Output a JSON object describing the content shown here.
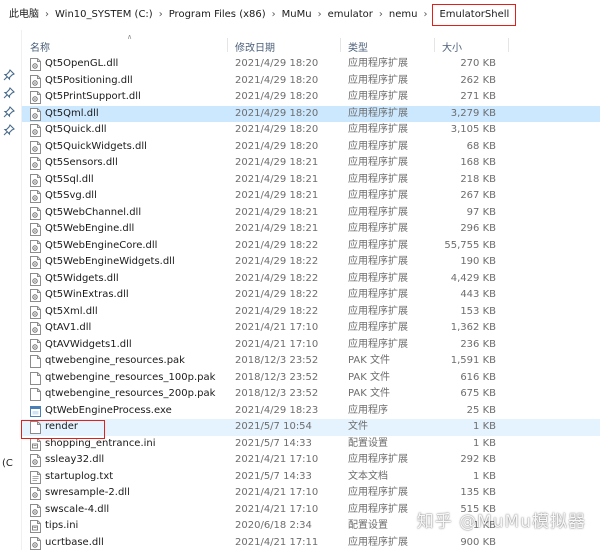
{
  "breadcrumb": {
    "items": [
      "此电脑",
      "Win10_SYSTEM (C:)",
      "Program Files (x86)",
      "MuMu",
      "emulator",
      "nemu"
    ],
    "current": "EmulatorShell"
  },
  "nav": {
    "partial_label": "(C"
  },
  "columns": {
    "name": "名称",
    "date": "修改日期",
    "type": "类型",
    "size": "大小"
  },
  "files": [
    {
      "name": "Qt5OpenGL.dll",
      "date": "2021/4/29 18:20",
      "type": "应用程序扩展",
      "size": "270 KB",
      "icon": "dll-file-icon"
    },
    {
      "name": "Qt5Positioning.dll",
      "date": "2021/4/29 18:20",
      "type": "应用程序扩展",
      "size": "262 KB",
      "icon": "dll-file-icon"
    },
    {
      "name": "Qt5PrintSupport.dll",
      "date": "2021/4/29 18:20",
      "type": "应用程序扩展",
      "size": "271 KB",
      "icon": "dll-file-icon"
    },
    {
      "name": "Qt5Qml.dll",
      "date": "2021/4/29 18:20",
      "type": "应用程序扩展",
      "size": "3,279 KB",
      "icon": "dll-file-icon"
    },
    {
      "name": "Qt5Quick.dll",
      "date": "2021/4/29 18:20",
      "type": "应用程序扩展",
      "size": "3,105 KB",
      "icon": "dll-file-icon"
    },
    {
      "name": "Qt5QuickWidgets.dll",
      "date": "2021/4/29 18:20",
      "type": "应用程序扩展",
      "size": "68 KB",
      "icon": "dll-file-icon"
    },
    {
      "name": "Qt5Sensors.dll",
      "date": "2021/4/29 18:21",
      "type": "应用程序扩展",
      "size": "168 KB",
      "icon": "dll-file-icon"
    },
    {
      "name": "Qt5Sql.dll",
      "date": "2021/4/29 18:21",
      "type": "应用程序扩展",
      "size": "218 KB",
      "icon": "dll-file-icon"
    },
    {
      "name": "Qt5Svg.dll",
      "date": "2021/4/29 18:21",
      "type": "应用程序扩展",
      "size": "267 KB",
      "icon": "dll-file-icon"
    },
    {
      "name": "Qt5WebChannel.dll",
      "date": "2021/4/29 18:21",
      "type": "应用程序扩展",
      "size": "97 KB",
      "icon": "dll-file-icon"
    },
    {
      "name": "Qt5WebEngine.dll",
      "date": "2021/4/29 18:21",
      "type": "应用程序扩展",
      "size": "296 KB",
      "icon": "dll-file-icon"
    },
    {
      "name": "Qt5WebEngineCore.dll",
      "date": "2021/4/29 18:22",
      "type": "应用程序扩展",
      "size": "55,755 KB",
      "icon": "dll-file-icon"
    },
    {
      "name": "Qt5WebEngineWidgets.dll",
      "date": "2021/4/29 18:22",
      "type": "应用程序扩展",
      "size": "190 KB",
      "icon": "dll-file-icon"
    },
    {
      "name": "Qt5Widgets.dll",
      "date": "2021/4/29 18:22",
      "type": "应用程序扩展",
      "size": "4,429 KB",
      "icon": "dll-file-icon"
    },
    {
      "name": "Qt5WinExtras.dll",
      "date": "2021/4/29 18:22",
      "type": "应用程序扩展",
      "size": "443 KB",
      "icon": "dll-file-icon"
    },
    {
      "name": "Qt5Xml.dll",
      "date": "2021/4/29 18:22",
      "type": "应用程序扩展",
      "size": "153 KB",
      "icon": "dll-file-icon"
    },
    {
      "name": "QtAV1.dll",
      "date": "2021/4/21 17:10",
      "type": "应用程序扩展",
      "size": "1,362 KB",
      "icon": "dll-file-icon"
    },
    {
      "name": "QtAVWidgets1.dll",
      "date": "2021/4/21 17:10",
      "type": "应用程序扩展",
      "size": "236 KB",
      "icon": "dll-file-icon"
    },
    {
      "name": "qtwebengine_resources.pak",
      "date": "2018/12/3 23:52",
      "type": "PAK 文件",
      "size": "1,591 KB",
      "icon": "document-file-icon"
    },
    {
      "name": "qtwebengine_resources_100p.pak",
      "date": "2018/12/3 23:52",
      "type": "PAK 文件",
      "size": "616 KB",
      "icon": "document-file-icon"
    },
    {
      "name": "qtwebengine_resources_200p.pak",
      "date": "2018/12/3 23:52",
      "type": "PAK 文件",
      "size": "675 KB",
      "icon": "document-file-icon"
    },
    {
      "name": "QtWebEngineProcess.exe",
      "date": "2021/4/29 18:23",
      "type": "应用程序",
      "size": "25 KB",
      "icon": "application-icon"
    },
    {
      "name": "render",
      "date": "2021/5/7 10:54",
      "type": "文件",
      "size": "1 KB",
      "icon": "blank-file-icon"
    },
    {
      "name": "shopping_entrance.ini",
      "date": "2021/5/7 14:33",
      "type": "配置设置",
      "size": "1 KB",
      "icon": "ini-file-icon"
    },
    {
      "name": "ssleay32.dll",
      "date": "2021/4/21 17:10",
      "type": "应用程序扩展",
      "size": "292 KB",
      "icon": "dll-file-icon"
    },
    {
      "name": "startuplog.txt",
      "date": "2021/5/7 14:33",
      "type": "文本文档",
      "size": "1 KB",
      "icon": "text-file-icon"
    },
    {
      "name": "swresample-2.dll",
      "date": "2021/4/21 17:10",
      "type": "应用程序扩展",
      "size": "135 KB",
      "icon": "dll-file-icon"
    },
    {
      "name": "swscale-4.dll",
      "date": "2021/4/21 17:10",
      "type": "应用程序扩展",
      "size": "515 KB",
      "icon": "dll-file-icon"
    },
    {
      "name": "tips.ini",
      "date": "2020/6/18 2:34",
      "type": "配置设置",
      "size": "1 KB",
      "icon": "ini-file-icon"
    },
    {
      "name": "ucrtbase.dll",
      "date": "2021/4/21 17:11",
      "type": "应用程序扩展",
      "size": "900 KB",
      "icon": "dll-file-icon"
    }
  ],
  "selected_index": 3,
  "highlighted_index": 22,
  "watermark": "知乎 @MuMu模拟器",
  "colors": {
    "selection": "#cce8ff",
    "hover": "#e5f3ff",
    "annotation_red": "#e0211b",
    "header_text": "#4c607a"
  }
}
